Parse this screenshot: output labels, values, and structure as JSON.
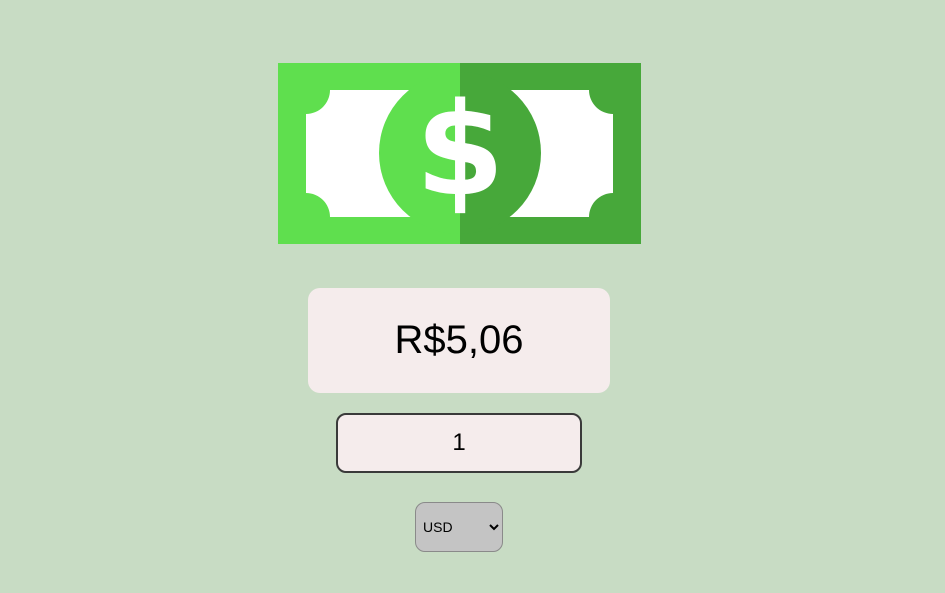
{
  "result": {
    "value": "R$5,06"
  },
  "amount_input": {
    "value": "1"
  },
  "currency_select": {
    "selected": "USD",
    "options": [
      "USD"
    ]
  },
  "colors": {
    "background": "#c8dcc4",
    "bill_light_green": "#5fdf4e",
    "bill_dark_green": "#47a83a",
    "box_background": "#f5ecec",
    "select_background": "#c4c4c4"
  },
  "icons": {
    "bill": "dollar-bill-icon"
  }
}
